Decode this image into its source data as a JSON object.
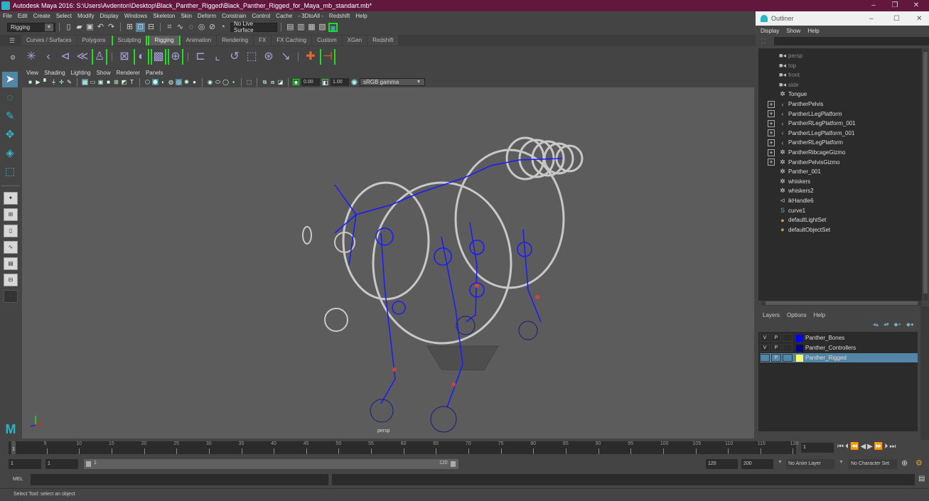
{
  "window": {
    "title": "Autodesk Maya 2016: S:\\Users\\Avdenton\\Desktop\\Black_Panther_Rigged\\Black_Panther_Rigged_for_Maya_mb_standart.mb*",
    "minimize": "–",
    "maximize": "❐",
    "close": "✕"
  },
  "menubar": [
    "File",
    "Edit",
    "Create",
    "Select",
    "Modify",
    "Display",
    "Windows",
    "Skeleton",
    "Skin",
    "Deform",
    "Constrain",
    "Control",
    "Cache",
    "- 3DtoAll -",
    "Redshift",
    "Help"
  ],
  "statusline": {
    "menuset": "Rigging",
    "live_surface": "No Live Surface"
  },
  "shelf_tabs": [
    {
      "label": "Curves / Surfaces",
      "state": ""
    },
    {
      "label": "Polygons",
      "state": ""
    },
    {
      "label": "Sculpting",
      "state": "bracket"
    },
    {
      "label": "Rigging",
      "state": "active"
    },
    {
      "label": "Animation",
      "state": ""
    },
    {
      "label": "Rendering",
      "state": ""
    },
    {
      "label": "FX",
      "state": ""
    },
    {
      "label": "FX Caching",
      "state": ""
    },
    {
      "label": "Custom",
      "state": ""
    },
    {
      "label": "XGen",
      "state": ""
    },
    {
      "label": "Redshift",
      "state": ""
    }
  ],
  "panel": {
    "menu": [
      "View",
      "Shading",
      "Lighting",
      "Show",
      "Renderer",
      "Panels"
    ],
    "exposure": "0.00",
    "gamma": "1.00",
    "color_space": "sRGB gamma",
    "camera_label": "persp"
  },
  "outliner": {
    "title": "Outliner",
    "menu": [
      "Display",
      "Show",
      "Help"
    ],
    "items": [
      {
        "label": "persp",
        "icon": "camera-icon",
        "expandable": false,
        "dim": true
      },
      {
        "label": "top",
        "icon": "camera-icon",
        "expandable": false,
        "dim": true
      },
      {
        "label": "front",
        "icon": "camera-icon",
        "expandable": false,
        "dim": true
      },
      {
        "label": "side",
        "icon": "camera-icon",
        "expandable": false,
        "dim": true
      },
      {
        "label": "Tongue",
        "icon": "transform-icon",
        "expandable": false,
        "dim": false
      },
      {
        "label": "PantherPelvis",
        "icon": "joint-icon",
        "expandable": true,
        "dim": false
      },
      {
        "label": "PantherLLegPlatform",
        "icon": "joint-icon",
        "expandable": true,
        "dim": false
      },
      {
        "label": "PantherRLegPlatform_001",
        "icon": "joint-icon",
        "expandable": true,
        "dim": false
      },
      {
        "label": "PantherLLegPlatform_001",
        "icon": "joint-icon",
        "expandable": true,
        "dim": false
      },
      {
        "label": "PantherRLegPlatform",
        "icon": "joint-icon",
        "expandable": true,
        "dim": false
      },
      {
        "label": "PantherRibcageGizmo",
        "icon": "transform-icon",
        "expandable": true,
        "dim": false
      },
      {
        "label": "PantherPelvisGizmo",
        "icon": "transform-icon",
        "expandable": true,
        "dim": false
      },
      {
        "label": "Panther_001",
        "icon": "transform-icon",
        "expandable": false,
        "dim": false
      },
      {
        "label": "whiskers",
        "icon": "transform-icon",
        "expandable": false,
        "dim": false
      },
      {
        "label": "whiskers2",
        "icon": "transform-icon",
        "expandable": false,
        "dim": false
      },
      {
        "label": "ikHandle6",
        "icon": "ik-handle-icon",
        "expandable": false,
        "dim": false
      },
      {
        "label": "curve1",
        "icon": "curve-icon",
        "expandable": false,
        "dim": false
      },
      {
        "label": "defaultLightSet",
        "icon": "set-icon",
        "expandable": false,
        "dim": false
      },
      {
        "label": "defaultObjectSet",
        "icon": "set-icon",
        "expandable": false,
        "dim": false
      }
    ]
  },
  "layers": {
    "menu": [
      "Layers",
      "Options",
      "Help"
    ],
    "rows": [
      {
        "v": "V",
        "p": "P",
        "name": "Panther_Bones",
        "color": "#0000ff",
        "selected": false
      },
      {
        "v": "V",
        "p": "P",
        "name": "Panther_Controllers",
        "color": "#000080",
        "selected": false
      },
      {
        "v": "",
        "p": "P",
        "name": "Panther_Rigged",
        "color": "#ffff66",
        "selected": true
      }
    ]
  },
  "timeline": {
    "ticks": [
      "5",
      "10",
      "15",
      "20",
      "25",
      "30",
      "35",
      "40",
      "45",
      "50",
      "55",
      "60",
      "65",
      "70",
      "75",
      "80",
      "85",
      "90",
      "95",
      "100",
      "105",
      "110",
      "115",
      "120"
    ],
    "current_frame_marker": "1",
    "current_frame": "1",
    "start_frame": "1",
    "playback_start": "1",
    "range_start_label": "1",
    "range_end_label": "120",
    "playback_end": "120",
    "end_frame": "200",
    "anim_layer": "No Anim Layer",
    "character_set": "No Character Set"
  },
  "cmdline": {
    "label": "MEL"
  },
  "helpline": {
    "text": "Select Tool: select an object"
  }
}
